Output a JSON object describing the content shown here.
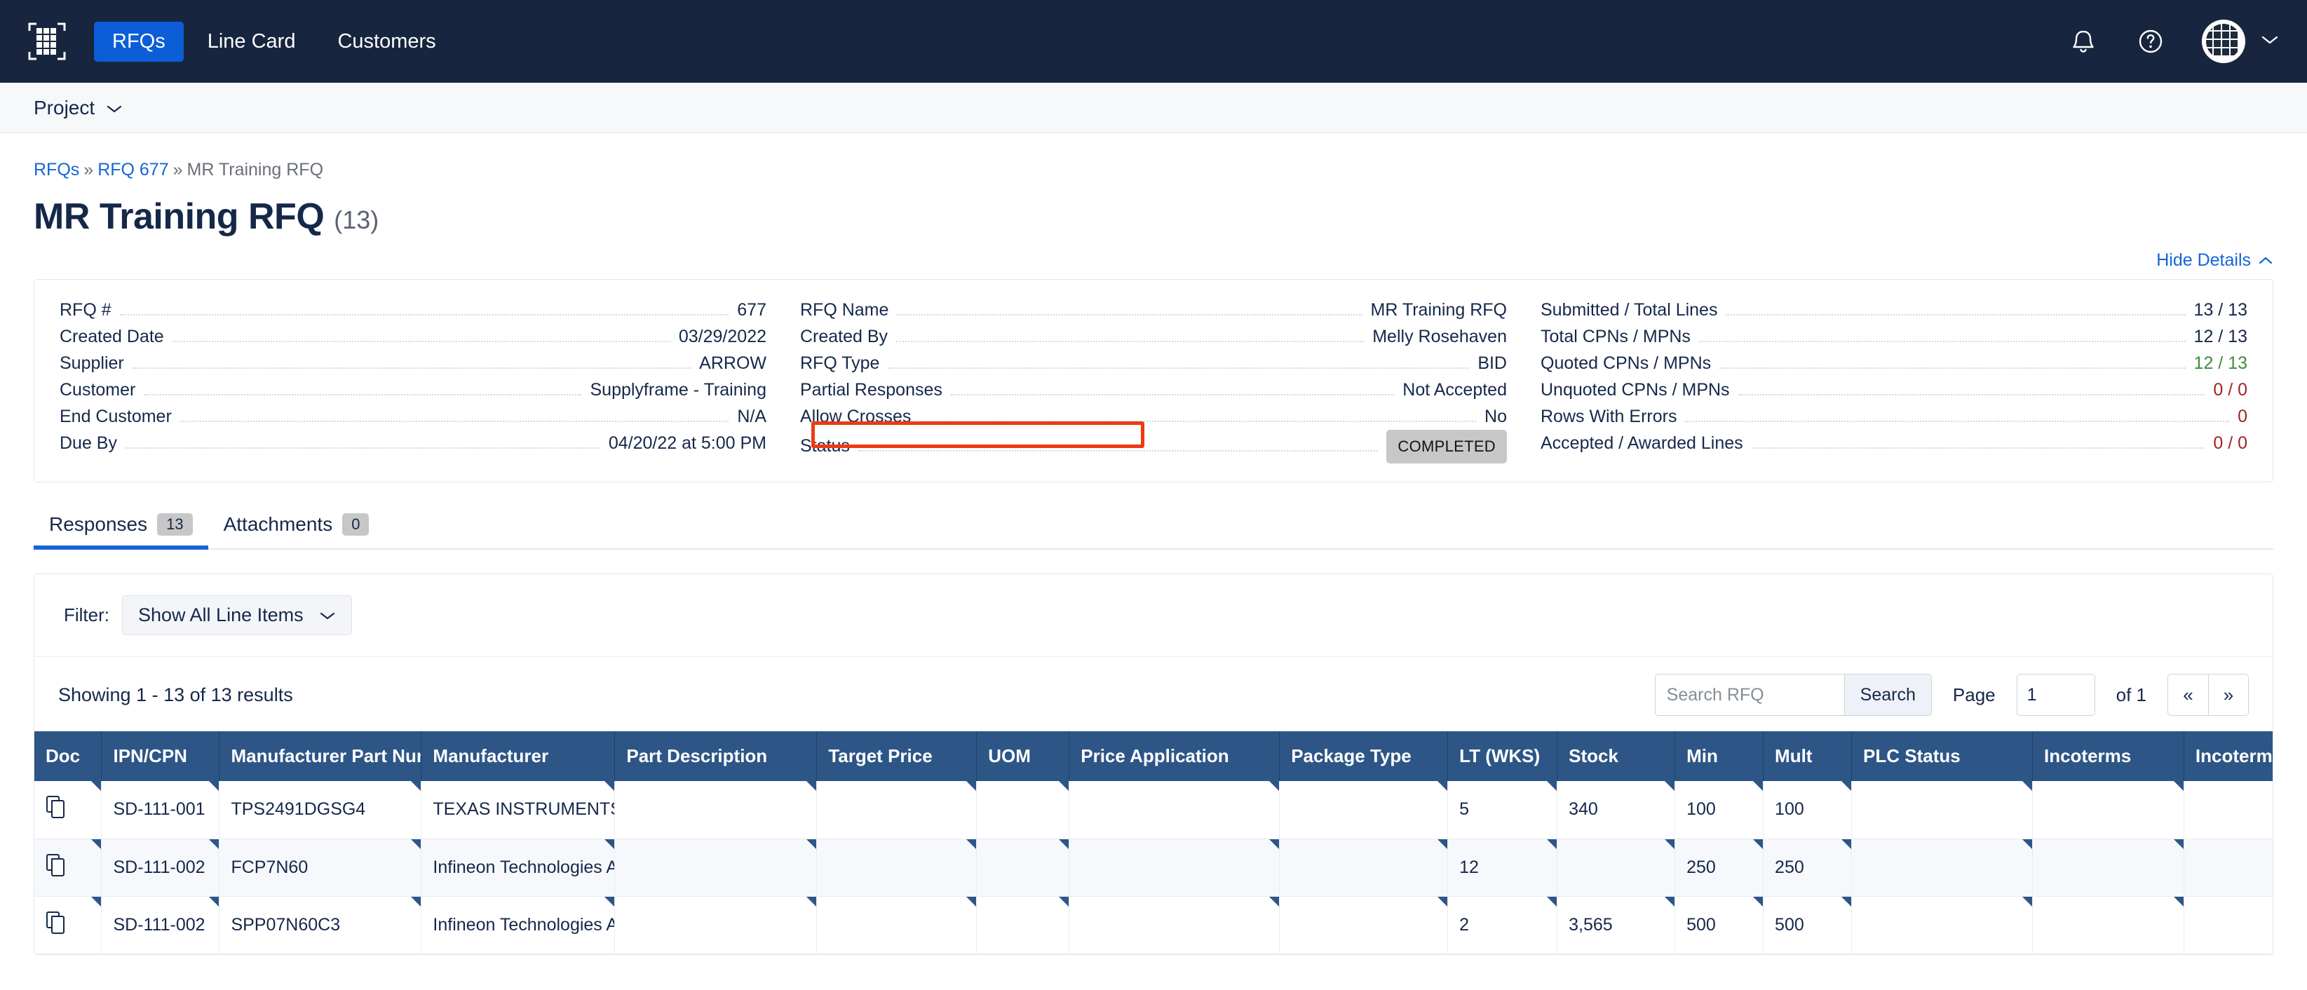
{
  "nav": {
    "logo_icon": "grid-logo-icon",
    "links": [
      {
        "label": "RFQs",
        "active": true
      },
      {
        "label": "Line Card",
        "active": false
      },
      {
        "label": "Customers",
        "active": false
      }
    ],
    "notification_icon": "bell-icon",
    "help_icon": "help-circle-icon",
    "avatar_icon": "grid-avatar-icon",
    "avatar_chevron_icon": "chevron-down-icon"
  },
  "project_bar": {
    "label": "Project",
    "chevron_icon": "chevron-down-icon"
  },
  "breadcrumb": {
    "items": [
      "RFQs",
      "RFQ 677",
      "MR Training RFQ"
    ],
    "separator": "»"
  },
  "header": {
    "title": "MR Training RFQ",
    "count": "(13)",
    "hide_details_label": "Hide Details",
    "hide_details_icon": "chevron-up-icon"
  },
  "details": {
    "col1": [
      {
        "label": "RFQ #",
        "value": "677"
      },
      {
        "label": "Created Date",
        "value": "03/29/2022"
      },
      {
        "label": "Supplier",
        "value": "ARROW"
      },
      {
        "label": "Customer",
        "value": "Supplyframe - Training"
      },
      {
        "label": "End Customer",
        "value": "N/A"
      },
      {
        "label": "Due By",
        "value": "04/20/22 at 5:00 PM"
      }
    ],
    "col2": [
      {
        "label": "RFQ Name",
        "value": "MR Training RFQ"
      },
      {
        "label": "Created By",
        "value": "Melly Rosehaven"
      },
      {
        "label": "RFQ Type",
        "value": "BID"
      },
      {
        "label": "Partial Responses",
        "value": "Not Accepted"
      },
      {
        "label": "Allow Crosses",
        "value": "No"
      },
      {
        "label": "Status",
        "value": "COMPLETED",
        "badge": true
      }
    ],
    "col3": [
      {
        "label": "Submitted / Total Lines",
        "value": "13 / 13",
        "color": "default"
      },
      {
        "label": "Total CPNs / MPNs",
        "value": "12 / 13",
        "color": "default"
      },
      {
        "label": "Quoted CPNs / MPNs",
        "value": "12 / 13",
        "color": "green"
      },
      {
        "label": "Unquoted CPNs / MPNs",
        "value": "0 / 0",
        "color": "red"
      },
      {
        "label": "Rows With Errors",
        "value": "0",
        "color": "red"
      },
      {
        "label": "Accepted / Awarded Lines",
        "value": "0 / 0",
        "color": "red"
      }
    ],
    "highlight_color": "#ee3b11",
    "badge_bg": "#c7c7c7"
  },
  "tabs": [
    {
      "label": "Responses",
      "badge": "13",
      "active": true
    },
    {
      "label": "Attachments",
      "badge": "0",
      "active": false
    }
  ],
  "filter": {
    "label": "Filter:",
    "selected": "Show All Line Items",
    "chevron_icon": "chevron-down-icon"
  },
  "results": {
    "showing_text": "Showing 1 - 13 of 13 results",
    "search_placeholder": "Search RFQ",
    "search_value": "",
    "search_button": "Search",
    "page_label": "Page",
    "page_value": "1",
    "of_label": "of 1",
    "prev_icon": "«",
    "next_icon": "»"
  },
  "table": {
    "columns": [
      "Doc",
      "IPN/CPN",
      "Manufacturer Part Number",
      "Manufacturer",
      "Part Description",
      "Target Price",
      "UOM",
      "Price Application",
      "Package Type",
      "LT (WKS)",
      "Stock",
      "Min",
      "Mult",
      "PLC Status",
      "Incoterms",
      "Incoterms L"
    ],
    "doc_icon": "copy-document-icon",
    "rows": [
      {
        "doc": "copy-document-icon",
        "ipn_cpn": "SD-111-001",
        "mpn": "TPS2491DGSG4",
        "manufacturer": "TEXAS INSTRUMENTS",
        "part_description": "",
        "target_price": "",
        "uom": "",
        "price_application": "",
        "package_type": "",
        "lt_wks": "5",
        "stock": "340",
        "min": "100",
        "mult": "100",
        "plc_status": "",
        "incoterms": "",
        "incoterms_l": ""
      },
      {
        "doc": "copy-document-icon",
        "ipn_cpn": "SD-111-002",
        "mpn": "FCP7N60",
        "manufacturer": "Infineon Technologies AG",
        "part_description": "",
        "target_price": "",
        "uom": "",
        "price_application": "",
        "package_type": "",
        "lt_wks": "12",
        "stock": "",
        "min": "250",
        "mult": "250",
        "plc_status": "",
        "incoterms": "",
        "incoterms_l": ""
      },
      {
        "doc": "copy-document-icon",
        "ipn_cpn": "SD-111-002",
        "mpn": "SPP07N60C3",
        "manufacturer": "Infineon Technologies AG",
        "part_description": "",
        "target_price": "",
        "uom": "",
        "price_application": "",
        "package_type": "",
        "lt_wks": "2",
        "stock": "3,565",
        "min": "500",
        "mult": "500",
        "plc_status": "",
        "incoterms": "",
        "incoterms_l": ""
      }
    ]
  }
}
